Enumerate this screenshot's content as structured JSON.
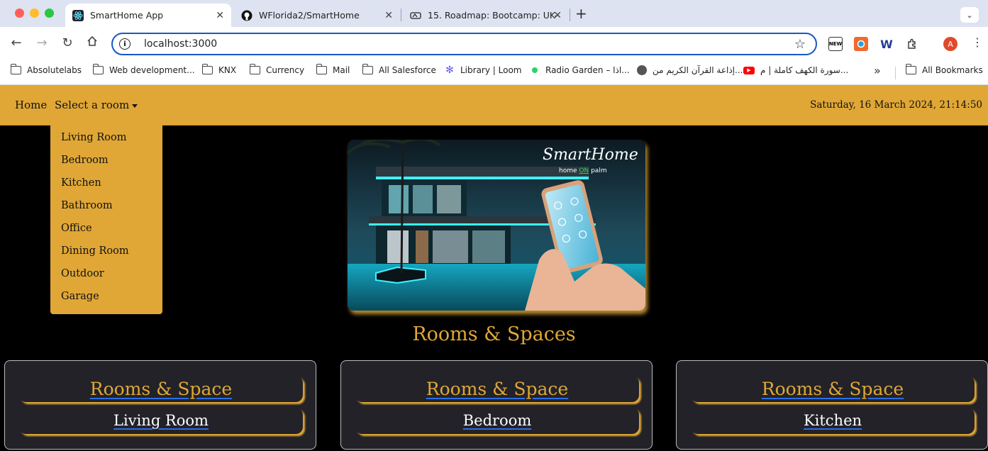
{
  "browser": {
    "tabs": [
      {
        "title": "SmartHome App",
        "active": true,
        "icon": "react-icon"
      },
      {
        "title": "WFlorida2/SmartHome",
        "active": false,
        "icon": "github-icon"
      },
      {
        "title": "15. Roadmap: Bootcamp: UK-",
        "active": false,
        "icon": "site-icon"
      }
    ],
    "url": "localhost:3000",
    "profile_initial": "A",
    "bookmarks": [
      {
        "label": "Absolutelabs",
        "icon": "folder-icon"
      },
      {
        "label": "Web development...",
        "icon": "folder-icon"
      },
      {
        "label": "KNX",
        "icon": "folder-icon"
      },
      {
        "label": "Currency",
        "icon": "folder-icon"
      },
      {
        "label": "Mail",
        "icon": "folder-icon"
      },
      {
        "label": "All Salesforce",
        "icon": "folder-icon"
      },
      {
        "label": "Library | Loom",
        "icon": "loom-icon"
      },
      {
        "label": "Radio Garden – اذا...",
        "icon": "radio-garden-icon"
      },
      {
        "label": "إذاعة القرآن الكريم من...",
        "icon": "globe-icon"
      },
      {
        "label": "سورة الكهف كاملة | م...",
        "icon": "youtube-icon"
      }
    ],
    "all_bookmarks": "All Bookmarks"
  },
  "navbar": {
    "home": "Home",
    "select_room": "Select a room",
    "datetime": "Saturday, 16 March 2024, 21:14:50"
  },
  "dropdown": {
    "items": [
      "Living Room",
      "Bedroom",
      "Kitchen",
      "Bathroom",
      "Office",
      "Dining Room",
      "Outdoor",
      "Garage"
    ]
  },
  "hero": {
    "logo_title": "SmartHome",
    "logo_tagline_pre": "home",
    "logo_tagline_on": "ON",
    "logo_tagline_post": "palm"
  },
  "section_title": "Rooms & Spaces",
  "cards": [
    {
      "heading": "Rooms & Space",
      "room": "Living Room"
    },
    {
      "heading": "Rooms & Space",
      "room": "Bedroom"
    },
    {
      "heading": "Rooms & Space",
      "room": "Kitchen"
    }
  ],
  "colors": {
    "accent": "#e0a736",
    "background": "#000000",
    "card": "#222228",
    "link_underline": "#2b6de8"
  }
}
